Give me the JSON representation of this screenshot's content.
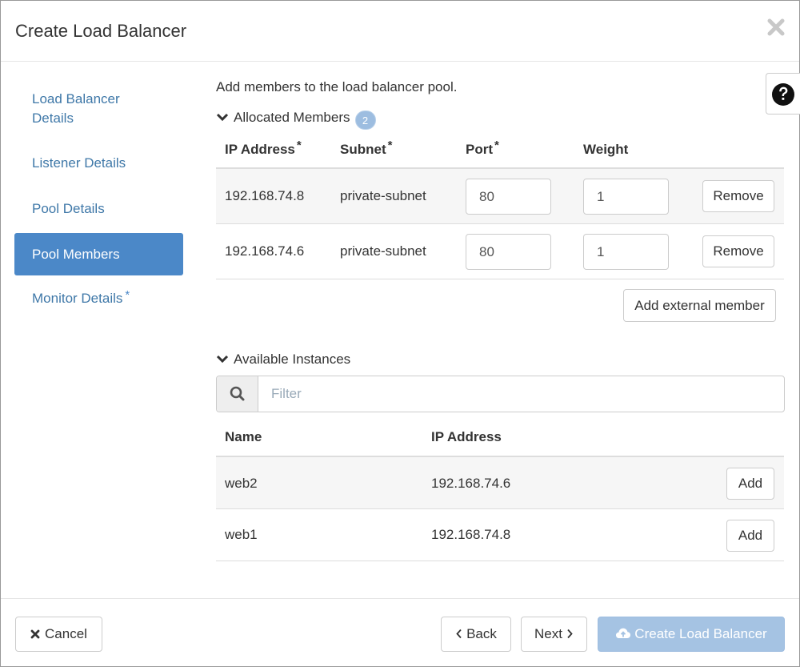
{
  "modal": {
    "title": "Create Load Balancer"
  },
  "wizard_nav": {
    "items": [
      {
        "label_line1": "Load Balancer",
        "label_line2": "Details",
        "active": false,
        "required": false
      },
      {
        "label": "Listener Details",
        "active": false,
        "required": false
      },
      {
        "label": "Pool Details",
        "active": false,
        "required": false
      },
      {
        "label": "Pool Members",
        "active": true,
        "required": false
      },
      {
        "label": "Monitor Details",
        "active": false,
        "required": true
      }
    ],
    "required_marker": "*"
  },
  "main": {
    "intro": "Add members to the load balancer pool.",
    "allocated": {
      "heading": "Allocated Members",
      "count": "2",
      "columns": [
        "IP Address",
        "Subnet",
        "Port",
        "Weight"
      ],
      "required_marker": "*",
      "rows": [
        {
          "ip": "192.168.74.8",
          "subnet": "private-subnet",
          "port": "80",
          "weight": "1",
          "action": "Remove"
        },
        {
          "ip": "192.168.74.6",
          "subnet": "private-subnet",
          "port": "80",
          "weight": "1",
          "action": "Remove"
        }
      ],
      "add_external_label": "Add external member"
    },
    "available": {
      "heading": "Available Instances",
      "filter_placeholder": "Filter",
      "columns": [
        "Name",
        "IP Address"
      ],
      "rows": [
        {
          "name": "web2",
          "ip": "192.168.74.6",
          "action": "Add"
        },
        {
          "name": "web1",
          "ip": "192.168.74.8",
          "action": "Add"
        }
      ]
    }
  },
  "footer": {
    "cancel_label": "Cancel",
    "back_label": "Back",
    "next_label": "Next",
    "create_label": "Create Load Balancer"
  },
  "colors": {
    "accent": "#4b88c8",
    "link": "#3f78a8",
    "primary_disabled": "#a5c3e3",
    "badge": "#9dbde0"
  },
  "icons": {
    "close": "close-icon",
    "help": "question-circle-icon",
    "chevron": "chevron-down-icon",
    "search": "search-icon",
    "cancel": "times-icon",
    "back": "chevron-left-icon",
    "next": "chevron-right-icon",
    "create": "cloud-upload-icon"
  }
}
